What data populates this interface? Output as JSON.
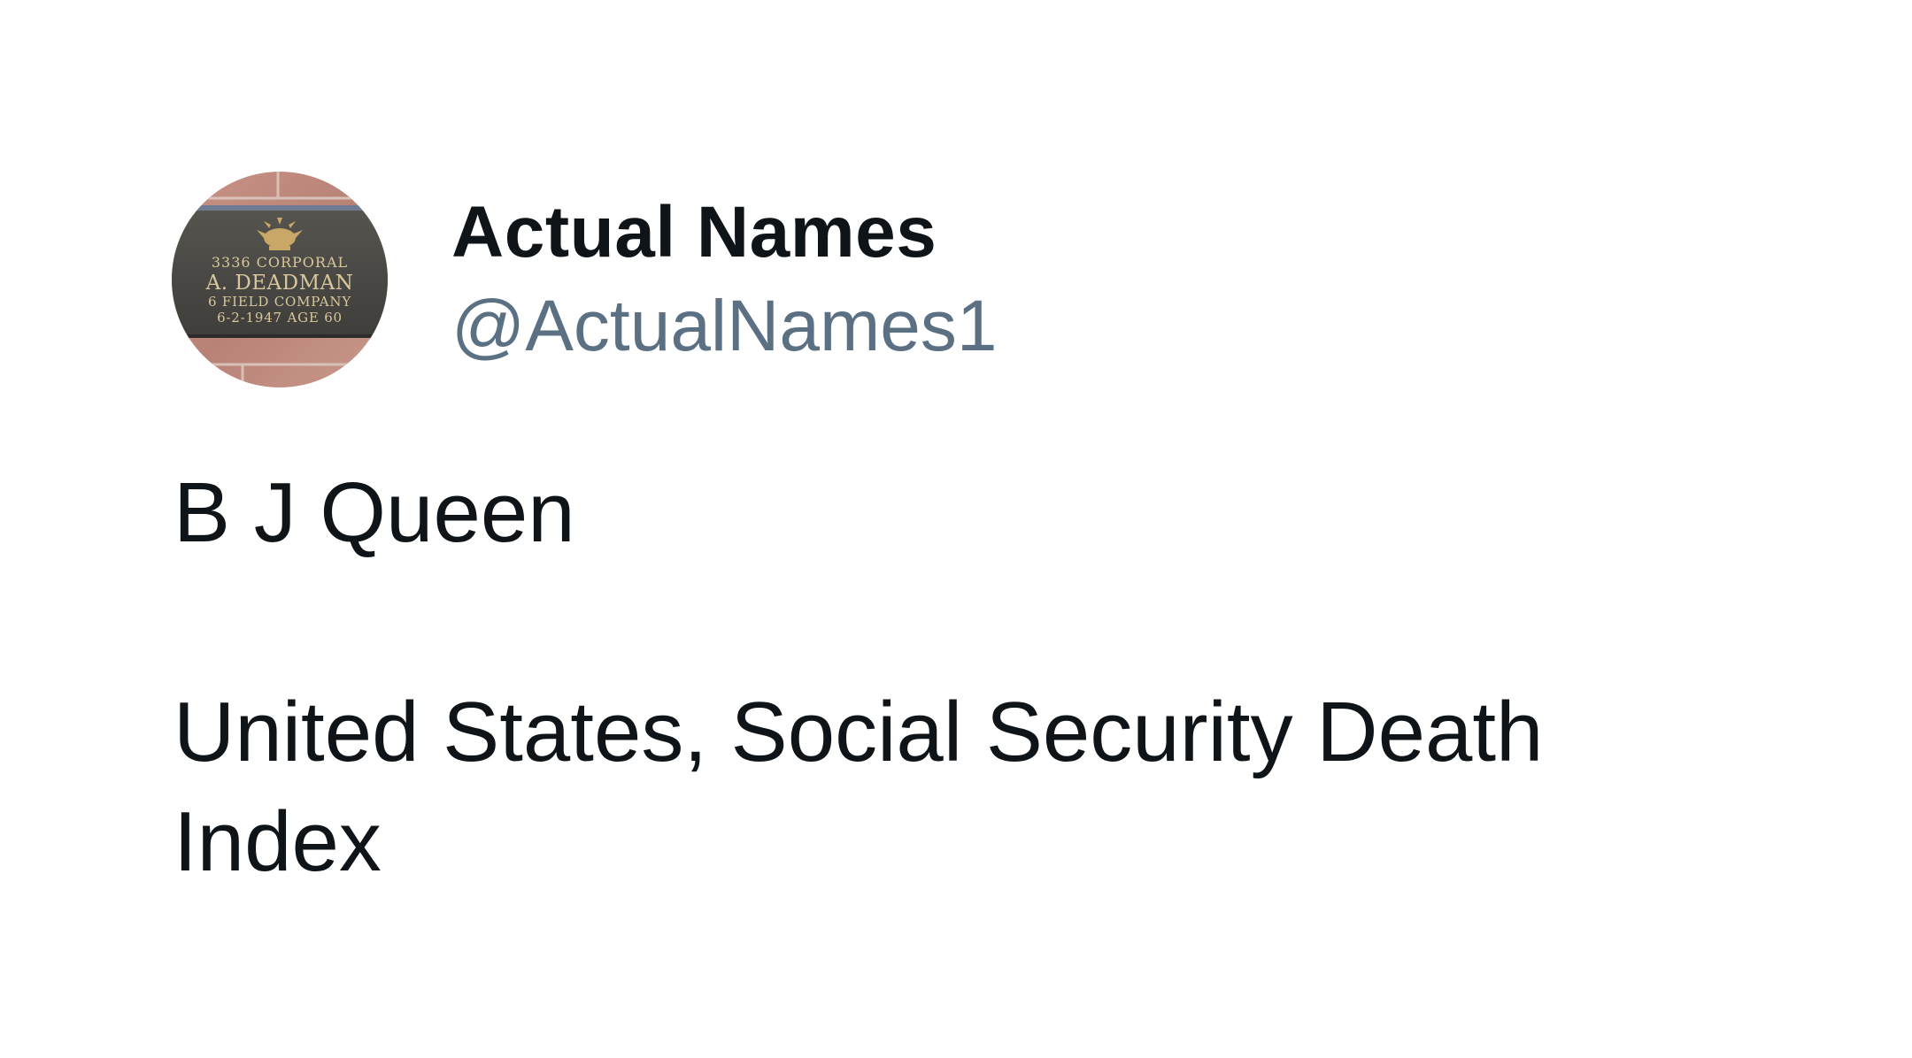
{
  "author": {
    "display_name": "Actual Names",
    "handle": "@ActualNames1",
    "avatar": {
      "icon": "memorial-plaque-avatar",
      "plaque_lines": [
        "3336 CORPORAL",
        "A. DEADMAN",
        "6 FIELD COMPANY",
        "6-2-1947  AGE 60"
      ]
    }
  },
  "tweet": {
    "lines": [
      "B J Queen",
      "United States, Social Security Death Index"
    ]
  },
  "colors": {
    "text": "#0f1419",
    "handle": "#5b7083",
    "background": "#ffffff",
    "brick": "#b98277",
    "plaque": "#4a4a48",
    "plaque_text": "#d8c79a"
  }
}
